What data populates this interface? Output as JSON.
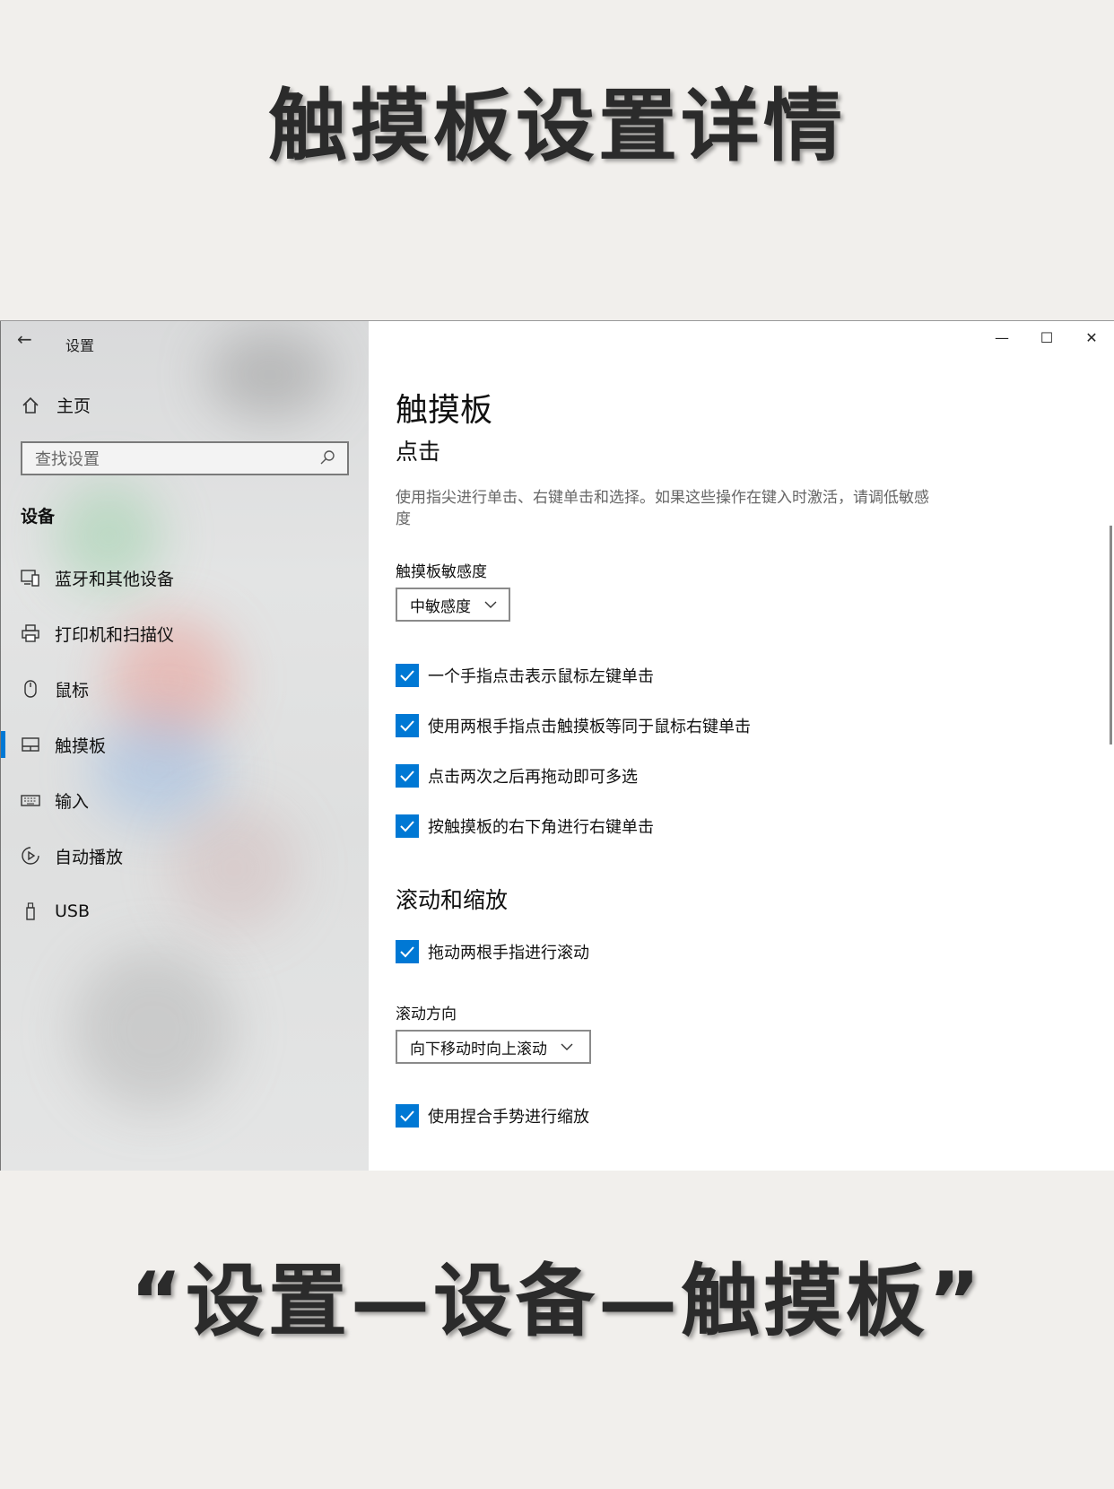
{
  "headline_top": "触摸板设置详情",
  "headline_bottom": "“设置—设备—触摸板”",
  "window": {
    "title": "设置",
    "accent": "#0078d4"
  },
  "sidebar": {
    "home_label": "主页",
    "search_placeholder": "查找设置",
    "section": "设备",
    "items": [
      {
        "label": "蓝牙和其他设备",
        "icon": "bluetooth-devices-icon"
      },
      {
        "label": "打印机和扫描仪",
        "icon": "printer-icon"
      },
      {
        "label": "鼠标",
        "icon": "mouse-icon"
      },
      {
        "label": "触摸板",
        "icon": "touchpad-icon",
        "active": true
      },
      {
        "label": "输入",
        "icon": "keyboard-icon"
      },
      {
        "label": "自动播放",
        "icon": "autoplay-icon"
      },
      {
        "label": "USB",
        "icon": "usb-icon"
      }
    ]
  },
  "main": {
    "page_title": "触摸板",
    "taps": {
      "heading": "点击",
      "description": "使用指尖进行单击、右键单击和选择。如果这些操作在键入时激活，请调低敏感度",
      "sensitivity_label": "触摸板敏感度",
      "sensitivity_value": "中敏感度",
      "checks": [
        "一个手指点击表示鼠标左键单击",
        "使用两根手指点击触摸板等同于鼠标右键单击",
        "点击两次之后再拖动即可多选",
        "按触摸板的右下角进行右键单击"
      ]
    },
    "scroll": {
      "heading": "滚动和缩放",
      "check_scroll": "拖动两根手指进行滚动",
      "direction_label": "滚动方向",
      "direction_value": "向下移动时向上滚动",
      "check_pinch": "使用捏合手势进行缩放"
    }
  }
}
